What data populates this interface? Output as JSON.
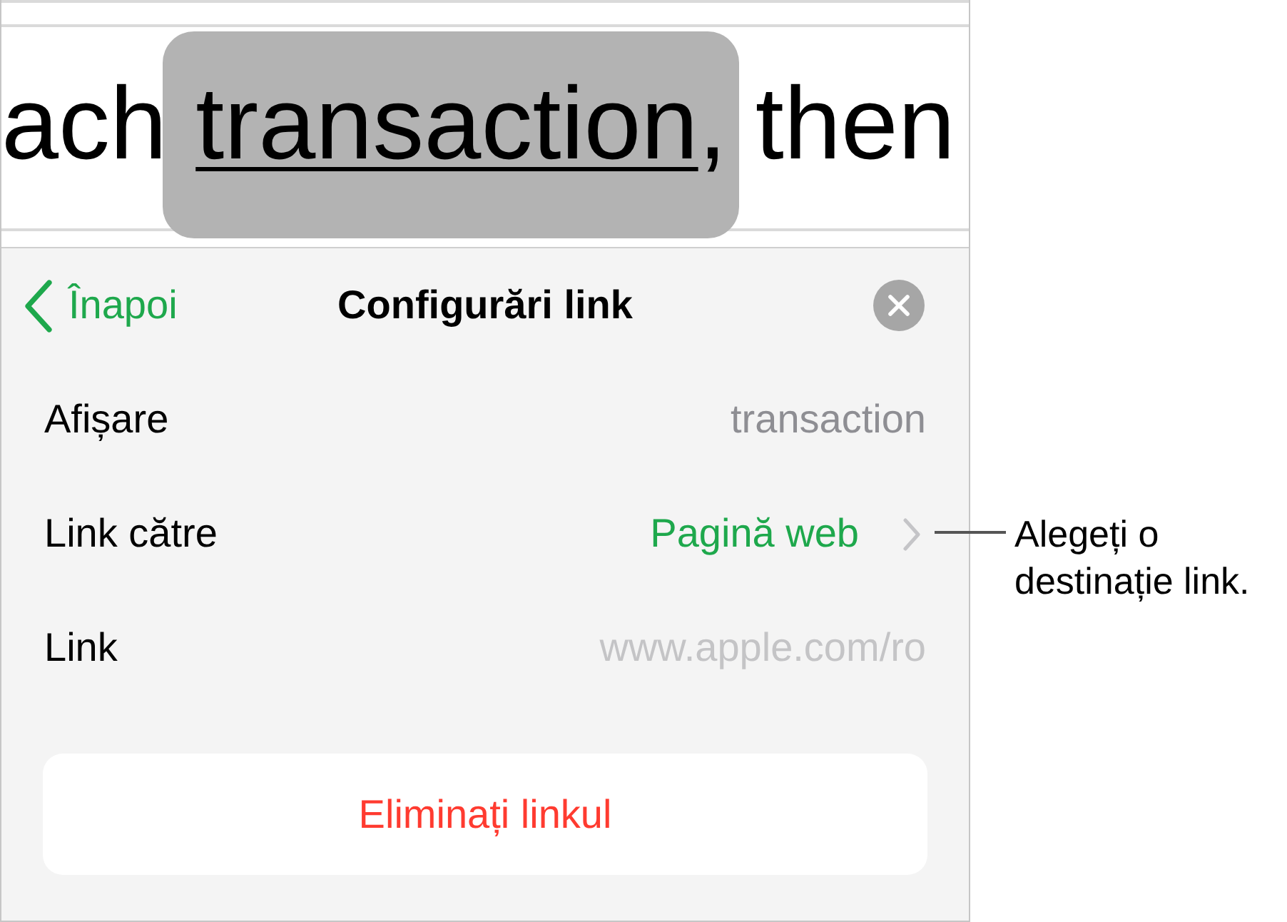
{
  "document": {
    "text_before": "ach",
    "link_text": "transaction",
    "text_after": ", then",
    "selected": true
  },
  "panel": {
    "back_label": "Înapoi",
    "title": "Configurări link"
  },
  "rows": [
    {
      "kind": "value",
      "label": "Afișare",
      "value": "transaction"
    },
    {
      "kind": "disclosure",
      "label": "Link către",
      "value": "Pagină web"
    },
    {
      "kind": "field",
      "label": "Link",
      "placeholder": "www.apple.com/ro"
    }
  ],
  "remove_button": "Eliminați linkul",
  "callout": {
    "text": "Alegeți o destinație link."
  }
}
